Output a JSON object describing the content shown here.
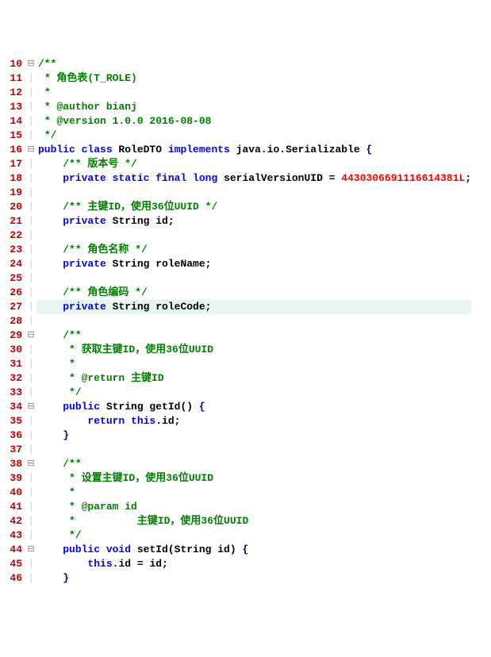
{
  "lines": [
    {
      "n": 10,
      "fold": "⊟",
      "indent": "",
      "seg": [
        {
          "cls": "c-comment",
          "t": "/**"
        }
      ]
    },
    {
      "n": 11,
      "fold": "│",
      "indent": " ",
      "seg": [
        {
          "cls": "c-comment",
          "t": "* 角色表(T_ROLE)"
        }
      ]
    },
    {
      "n": 12,
      "fold": "│",
      "indent": " ",
      "seg": [
        {
          "cls": "c-comment",
          "t": "*"
        }
      ]
    },
    {
      "n": 13,
      "fold": "│",
      "indent": " ",
      "seg": [
        {
          "cls": "c-comment",
          "t": "* @author bianj"
        }
      ]
    },
    {
      "n": 14,
      "fold": "│",
      "indent": " ",
      "seg": [
        {
          "cls": "c-comment",
          "t": "* @version 1.0.0 2016-08-08"
        }
      ]
    },
    {
      "n": 15,
      "fold": "│",
      "indent": " ",
      "seg": [
        {
          "cls": "c-comment",
          "t": "*/"
        }
      ]
    },
    {
      "n": 16,
      "fold": "⊟",
      "indent": "",
      "seg": [
        {
          "cls": "c-kw",
          "t": "public class "
        },
        {
          "cls": "c-ident",
          "t": "RoleDTO "
        },
        {
          "cls": "c-kw",
          "t": "implements "
        },
        {
          "cls": "c-ident",
          "t": "java.io.Serializable "
        },
        {
          "cls": "c-brace",
          "t": "{"
        }
      ]
    },
    {
      "n": 17,
      "fold": "│",
      "indent": "    ",
      "seg": [
        {
          "cls": "c-comment",
          "t": "/** 版本号 */"
        }
      ]
    },
    {
      "n": 18,
      "fold": "│",
      "indent": "    ",
      "seg": [
        {
          "cls": "c-kw",
          "t": "private static final long "
        },
        {
          "cls": "c-ident",
          "t": "serialVersionUID = "
        },
        {
          "cls": "c-num",
          "t": "4430306691116614381L"
        },
        {
          "cls": "c-ident",
          "t": ";"
        }
      ]
    },
    {
      "n": 19,
      "fold": "│",
      "indent": "",
      "seg": []
    },
    {
      "n": 20,
      "fold": "│",
      "indent": "    ",
      "seg": [
        {
          "cls": "c-comment",
          "t": "/** 主键ID，使用36位UUID */"
        }
      ]
    },
    {
      "n": 21,
      "fold": "│",
      "indent": "    ",
      "seg": [
        {
          "cls": "c-kw",
          "t": "private "
        },
        {
          "cls": "c-ident",
          "t": "String id;"
        }
      ]
    },
    {
      "n": 22,
      "fold": "│",
      "indent": "",
      "seg": []
    },
    {
      "n": 23,
      "fold": "│",
      "indent": "    ",
      "seg": [
        {
          "cls": "c-comment",
          "t": "/** 角色名称 */"
        }
      ]
    },
    {
      "n": 24,
      "fold": "│",
      "indent": "    ",
      "seg": [
        {
          "cls": "c-kw",
          "t": "private "
        },
        {
          "cls": "c-ident",
          "t": "String roleName;"
        }
      ]
    },
    {
      "n": 25,
      "fold": "│",
      "indent": "",
      "seg": []
    },
    {
      "n": 26,
      "fold": "│",
      "indent": "    ",
      "seg": [
        {
          "cls": "c-comment",
          "t": "/** 角色编码 */"
        }
      ]
    },
    {
      "n": 27,
      "fold": "│",
      "indent": "    ",
      "hl": true,
      "seg": [
        {
          "cls": "c-kw",
          "t": "private "
        },
        {
          "cls": "c-ident",
          "t": "String roleCode;"
        }
      ]
    },
    {
      "n": 28,
      "fold": "│",
      "indent": "",
      "seg": []
    },
    {
      "n": 29,
      "fold": "⊟",
      "indent": "    ",
      "seg": [
        {
          "cls": "c-comment",
          "t": "/**"
        }
      ]
    },
    {
      "n": 30,
      "fold": "│",
      "indent": "     ",
      "seg": [
        {
          "cls": "c-comment",
          "t": "* 获取主键ID，使用36位UUID"
        }
      ]
    },
    {
      "n": 31,
      "fold": "│",
      "indent": "     ",
      "seg": [
        {
          "cls": "c-comment",
          "t": "*"
        }
      ]
    },
    {
      "n": 32,
      "fold": "│",
      "indent": "     ",
      "seg": [
        {
          "cls": "c-comment",
          "t": "* @return 主键ID"
        }
      ]
    },
    {
      "n": 33,
      "fold": "│",
      "indent": "     ",
      "seg": [
        {
          "cls": "c-comment",
          "t": "*/"
        }
      ]
    },
    {
      "n": 34,
      "fold": "⊟",
      "indent": "    ",
      "seg": [
        {
          "cls": "c-kw",
          "t": "public "
        },
        {
          "cls": "c-ident",
          "t": "String getId() "
        },
        {
          "cls": "c-brace",
          "t": "{"
        }
      ]
    },
    {
      "n": 35,
      "fold": "│",
      "indent": "        ",
      "seg": [
        {
          "cls": "c-kw",
          "t": "return this"
        },
        {
          "cls": "c-ident",
          "t": ".id;"
        }
      ]
    },
    {
      "n": 36,
      "fold": "│",
      "indent": "    ",
      "seg": [
        {
          "cls": "c-brace",
          "t": "}"
        }
      ]
    },
    {
      "n": 37,
      "fold": "│",
      "indent": "",
      "seg": []
    },
    {
      "n": 38,
      "fold": "⊟",
      "indent": "    ",
      "seg": [
        {
          "cls": "c-comment",
          "t": "/**"
        }
      ]
    },
    {
      "n": 39,
      "fold": "│",
      "indent": "     ",
      "seg": [
        {
          "cls": "c-comment",
          "t": "* 设置主键ID，使用36位UUID"
        }
      ]
    },
    {
      "n": 40,
      "fold": "│",
      "indent": "     ",
      "seg": [
        {
          "cls": "c-comment",
          "t": "*"
        }
      ]
    },
    {
      "n": 41,
      "fold": "│",
      "indent": "     ",
      "seg": [
        {
          "cls": "c-comment",
          "t": "* @param id"
        }
      ]
    },
    {
      "n": 42,
      "fold": "│",
      "indent": "     ",
      "seg": [
        {
          "cls": "c-comment",
          "t": "*          主键ID，使用36位UUID"
        }
      ]
    },
    {
      "n": 43,
      "fold": "│",
      "indent": "     ",
      "seg": [
        {
          "cls": "c-comment",
          "t": "*/"
        }
      ]
    },
    {
      "n": 44,
      "fold": "⊟",
      "indent": "    ",
      "seg": [
        {
          "cls": "c-kw",
          "t": "public void "
        },
        {
          "cls": "c-ident",
          "t": "setId(String id) "
        },
        {
          "cls": "c-brace",
          "t": "{"
        }
      ]
    },
    {
      "n": 45,
      "fold": "│",
      "indent": "        ",
      "seg": [
        {
          "cls": "c-kw",
          "t": "this"
        },
        {
          "cls": "c-ident",
          "t": ".id = id;"
        }
      ]
    },
    {
      "n": 46,
      "fold": "│",
      "indent": "    ",
      "seg": [
        {
          "cls": "c-brace",
          "t": "}"
        }
      ]
    }
  ]
}
